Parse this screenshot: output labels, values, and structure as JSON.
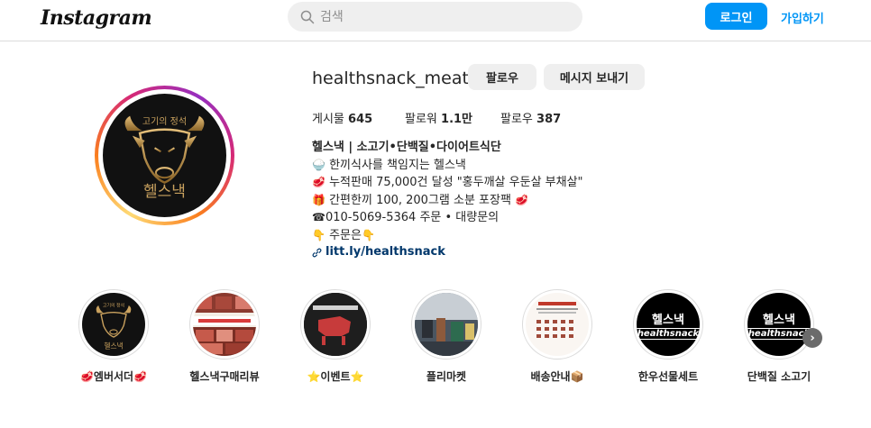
{
  "header": {
    "logo": "Instagram",
    "search_placeholder": "검색",
    "login_label": "로그인",
    "signup_label": "가입하기"
  },
  "profile": {
    "username": "healthsnack_meat",
    "follow_label": "팔로우",
    "message_label": "메시지 보내기",
    "avatar_top_text": "고기의 정석",
    "avatar_bottom_text": "헬스낵",
    "stats": [
      {
        "label": "게시물",
        "value": "645"
      },
      {
        "label": "팔로워",
        "value": "1.1만"
      },
      {
        "label": "팔로우",
        "value": "387"
      }
    ],
    "bio": {
      "name": "헬스낵 | 소고기•단백질•다이어트식단",
      "lines": [
        {
          "emoji": "🍚",
          "text": "한끼식사를 책임지는 헬스낵"
        },
        {
          "emoji": "🥩",
          "text": "누적판매 75,000건 달성 \"홍두깨살 우둔살 부채살\""
        },
        {
          "emoji": "🎁",
          "text": "간편한끼 100, 200그램 소분 포장팩",
          "emoji_after": "🥩"
        },
        {
          "emoji": "☎",
          "text": "010-5069-5364 주문 • 대량문의"
        },
        {
          "emoji": "👇",
          "text": "주문은",
          "emoji_after": "👇"
        }
      ],
      "link": "litt.ly/healthsnack"
    }
  },
  "highlights": [
    {
      "label": "🥩엠버서더🥩"
    },
    {
      "label": "헬스낵구매리뷰"
    },
    {
      "label": "⭐이벤트⭐"
    },
    {
      "label": "플리마켓"
    },
    {
      "label": "배송안내📦"
    },
    {
      "label": "한우선물세트",
      "logo_k": "헬스낵",
      "logo_e": "healthsnack"
    },
    {
      "label": "단백질 소고기",
      "logo_k": "헬스낵",
      "logo_e": "healthsnack"
    }
  ],
  "colors": {
    "accent": "#0095f6",
    "link": "#00376b",
    "gold": "#c9a15e"
  }
}
